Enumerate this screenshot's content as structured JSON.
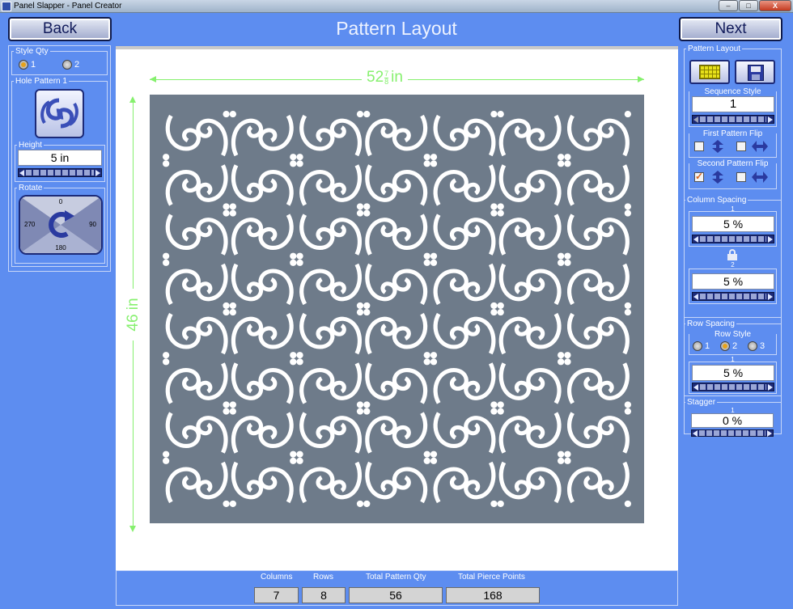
{
  "window": {
    "title": "Panel Slapper - Panel Creator",
    "minimize": "–",
    "maximize": "□",
    "close": "X"
  },
  "nav": {
    "back": "Back",
    "next": "Next",
    "title": "Pattern Layout"
  },
  "left": {
    "style_qty": {
      "label": "Style Qty",
      "options": [
        "1",
        "2"
      ],
      "selected": "1"
    },
    "hole_pattern": {
      "label": "Hole Pattern 1"
    },
    "height": {
      "label": "Height",
      "value": "5 in"
    },
    "rotate": {
      "label": "Rotate",
      "top": "0",
      "left": "270",
      "right": "90",
      "bottom": "180"
    }
  },
  "canvas": {
    "width_whole": "52",
    "width_num": "7",
    "width_den": "8",
    "width_unit": "in",
    "height_label": "46 in",
    "columns": 7,
    "rows": 8,
    "panel_color": "#6e7b8a",
    "dim_color": "#86f06e"
  },
  "right": {
    "pattern_layout": {
      "label": "Pattern Layout"
    },
    "sequence_style": {
      "label": "Sequence Style",
      "value": "1"
    },
    "first_flip": {
      "label": "First Pattern Flip",
      "checked": [
        false,
        false
      ]
    },
    "second_flip": {
      "label": "Second Pattern Flip",
      "checked": [
        true,
        false
      ]
    },
    "column_spacing": {
      "label": "Column Spacing",
      "sub1": "1",
      "value1": "5 %",
      "sub2": "2",
      "value2": "5 %"
    },
    "row_spacing": {
      "label": "Row Spacing",
      "row_style_label": "Row Style",
      "options": [
        "1",
        "2",
        "3"
      ],
      "selected": "2",
      "sub": "1",
      "value": "5 %"
    },
    "stagger": {
      "label": "Stagger",
      "sub": "1",
      "value": "0 %"
    }
  },
  "stats": [
    {
      "label": "Columns",
      "value": "7"
    },
    {
      "label": "Rows",
      "value": "8"
    },
    {
      "label": "Total Pattern Qty",
      "value": "56"
    },
    {
      "label": "Total Pierce Points",
      "value": "168"
    }
  ]
}
